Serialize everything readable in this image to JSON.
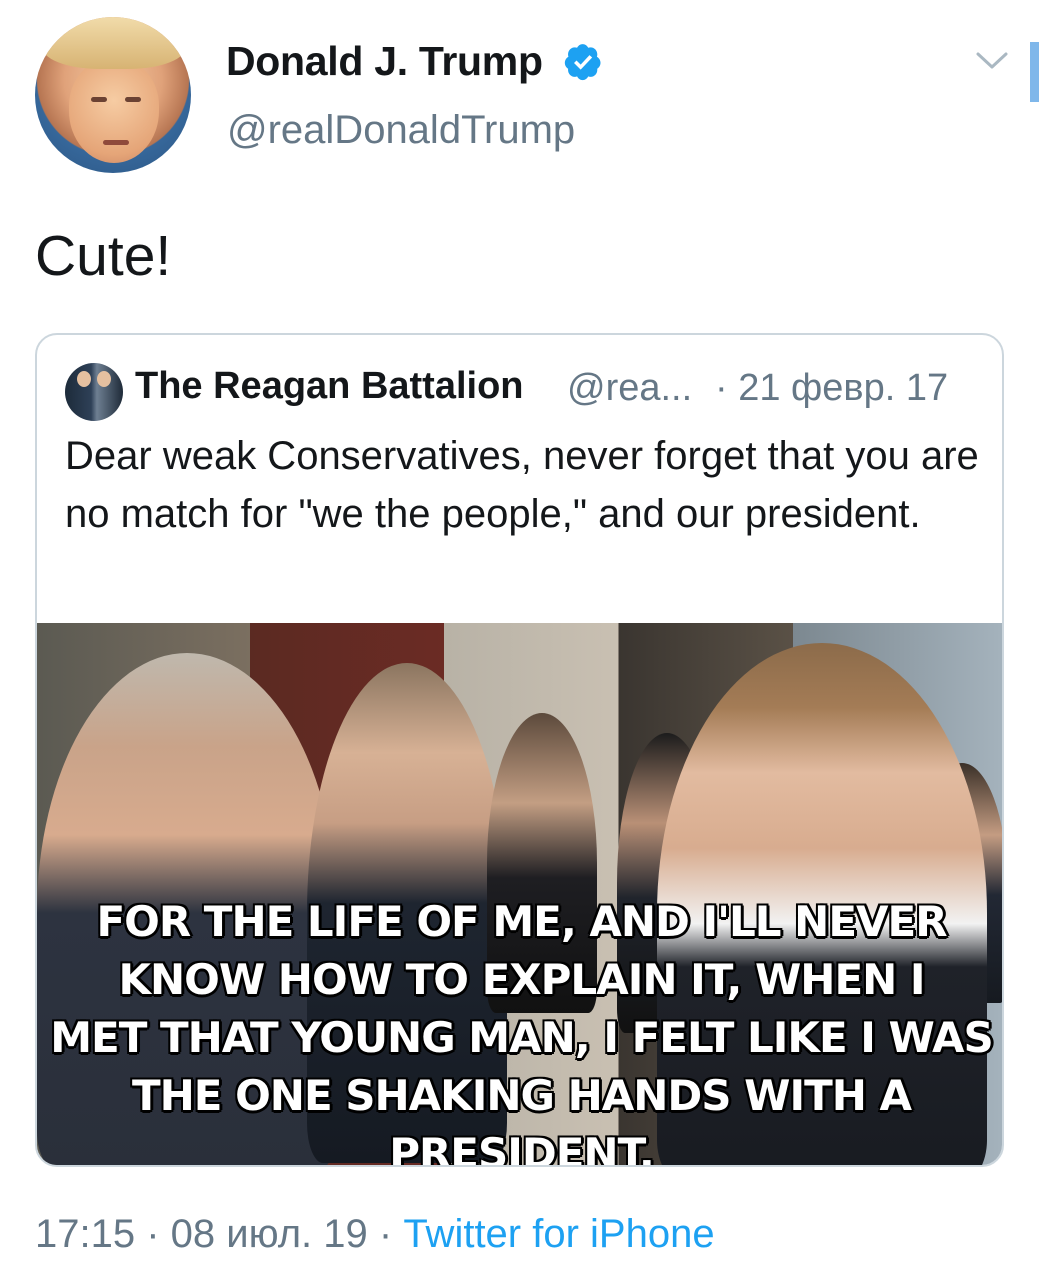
{
  "tweet": {
    "author_name": "Donald J. Trump",
    "author_handle": "@realDonaldTrump",
    "verified": true,
    "text": "Cute!",
    "timestamp": "17:15 · 08 июл. 19 · ",
    "source": "Twitter for iPhone"
  },
  "quoted_tweet": {
    "author_name": "The Reagan Battalion",
    "author_handle": "@rea...",
    "date": "· 21 февр. 17",
    "text": "Dear weak Conservatives, never forget that you are no match for \"we the people,\" and our president.",
    "image_caption_lines": [
      "FOR THE LIFE OF ME, AND I'LL NEVER",
      "KNOW HOW TO EXPLAIN IT, WHEN I",
      "MET THAT YOUNG MAN, I FELT LIKE I WAS",
      "THE ONE SHAKING HANDS WITH A PRESIDENT."
    ]
  },
  "icons": {
    "verified": "verified-badge-icon",
    "menu": "chevron-down-icon"
  },
  "colors": {
    "link": "#1da1f2",
    "muted": "#657786",
    "border": "#ccd6dd"
  }
}
